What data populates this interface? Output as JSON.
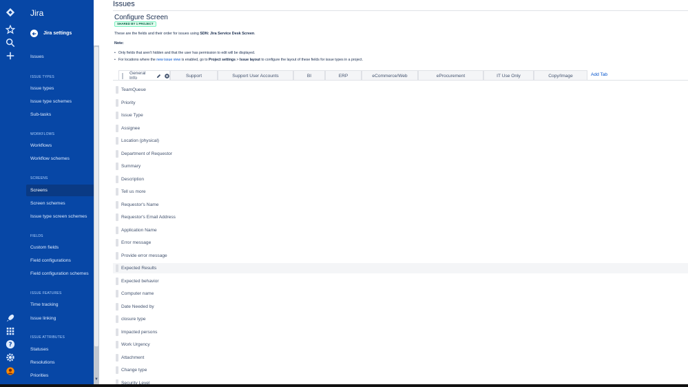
{
  "rail": {
    "icons": [
      "jira-logo-icon",
      "star-icon",
      "search-icon",
      "create-plus-icon",
      "rocket-icon",
      "app-switcher-icon",
      "help-icon",
      "settings-gear-icon",
      "avatar"
    ]
  },
  "sidebar": {
    "title": "Jira",
    "back_label": "Jira settings",
    "issues_label": "Issues",
    "sections": [
      {
        "heading": "ISSUE TYPES",
        "items": [
          "Issue types",
          "Issue type schemes",
          "Sub-tasks"
        ]
      },
      {
        "heading": "WORKFLOWS",
        "items": [
          "Workflows",
          "Workflow schemes"
        ]
      },
      {
        "heading": "SCREENS",
        "items": [
          "Screens",
          "Screen schemes",
          "Issue type screen schemes"
        ]
      },
      {
        "heading": "FIELDS",
        "items": [
          "Custom fields",
          "Field configurations",
          "Field configuration schemes"
        ]
      },
      {
        "heading": "ISSUE FEATURES",
        "items": [
          "Time tracking",
          "Issue linking"
        ]
      },
      {
        "heading": "ISSUE ATTRIBUTES",
        "items": [
          "Statuses",
          "Resolutions",
          "Priorities"
        ]
      }
    ],
    "active_item": "Screens"
  },
  "main": {
    "page_title": "Issues",
    "screen_title": "Configure Screen",
    "shared_badge": "SHARED BY 1 PROJECT",
    "desc_prefix": "These are the fields and their order for issues using ",
    "desc_bold": "SDN: Jira Service Desk Screen",
    "desc_suffix": ".",
    "note_label": "Note:",
    "note1": "Only fields that aren't hidden and that the user has permission to edit will be displayed.",
    "note2_prefix": "For locations where the ",
    "note2_link": "new issue view",
    "note2_mid1": " is enabled, go to ",
    "note2_bold1": "Project settings",
    "note2_mid2": " > ",
    "note2_bold2": "Issue layout",
    "note2_suffix": " to configure the layout of these fields for issue types in a project.",
    "tabs": [
      "General Info",
      "Support",
      "Support User Accounts",
      "BI",
      "ERP",
      "eCommerce/Web",
      "eProcurement",
      "IT Use Only",
      "Copy/Image"
    ],
    "add_tab": "Add Tab",
    "fields": [
      "TeamQueue",
      "Priority",
      "Issue Type",
      "Assignee",
      "Location (physical)",
      "Department of Requestor",
      "Summary",
      "Description",
      "Tell us more",
      "Requestor's Name",
      "Requestor's Email Address",
      "Application Name",
      "Error message",
      "Provide error message",
      "Expected Results",
      "Expected behavior",
      "Computer name",
      "Date Needed by",
      "closure type",
      "Impacted persons",
      "Work Urgency",
      "Attachment",
      "Change type",
      "Security Level"
    ],
    "highlighted_field": "Expected Results"
  },
  "colors": {
    "nav": "#0747a6",
    "active_item": "#0a3a84",
    "link": "#0052cc",
    "badge_text": "#006644",
    "badge_bg": "#e3fcef"
  }
}
